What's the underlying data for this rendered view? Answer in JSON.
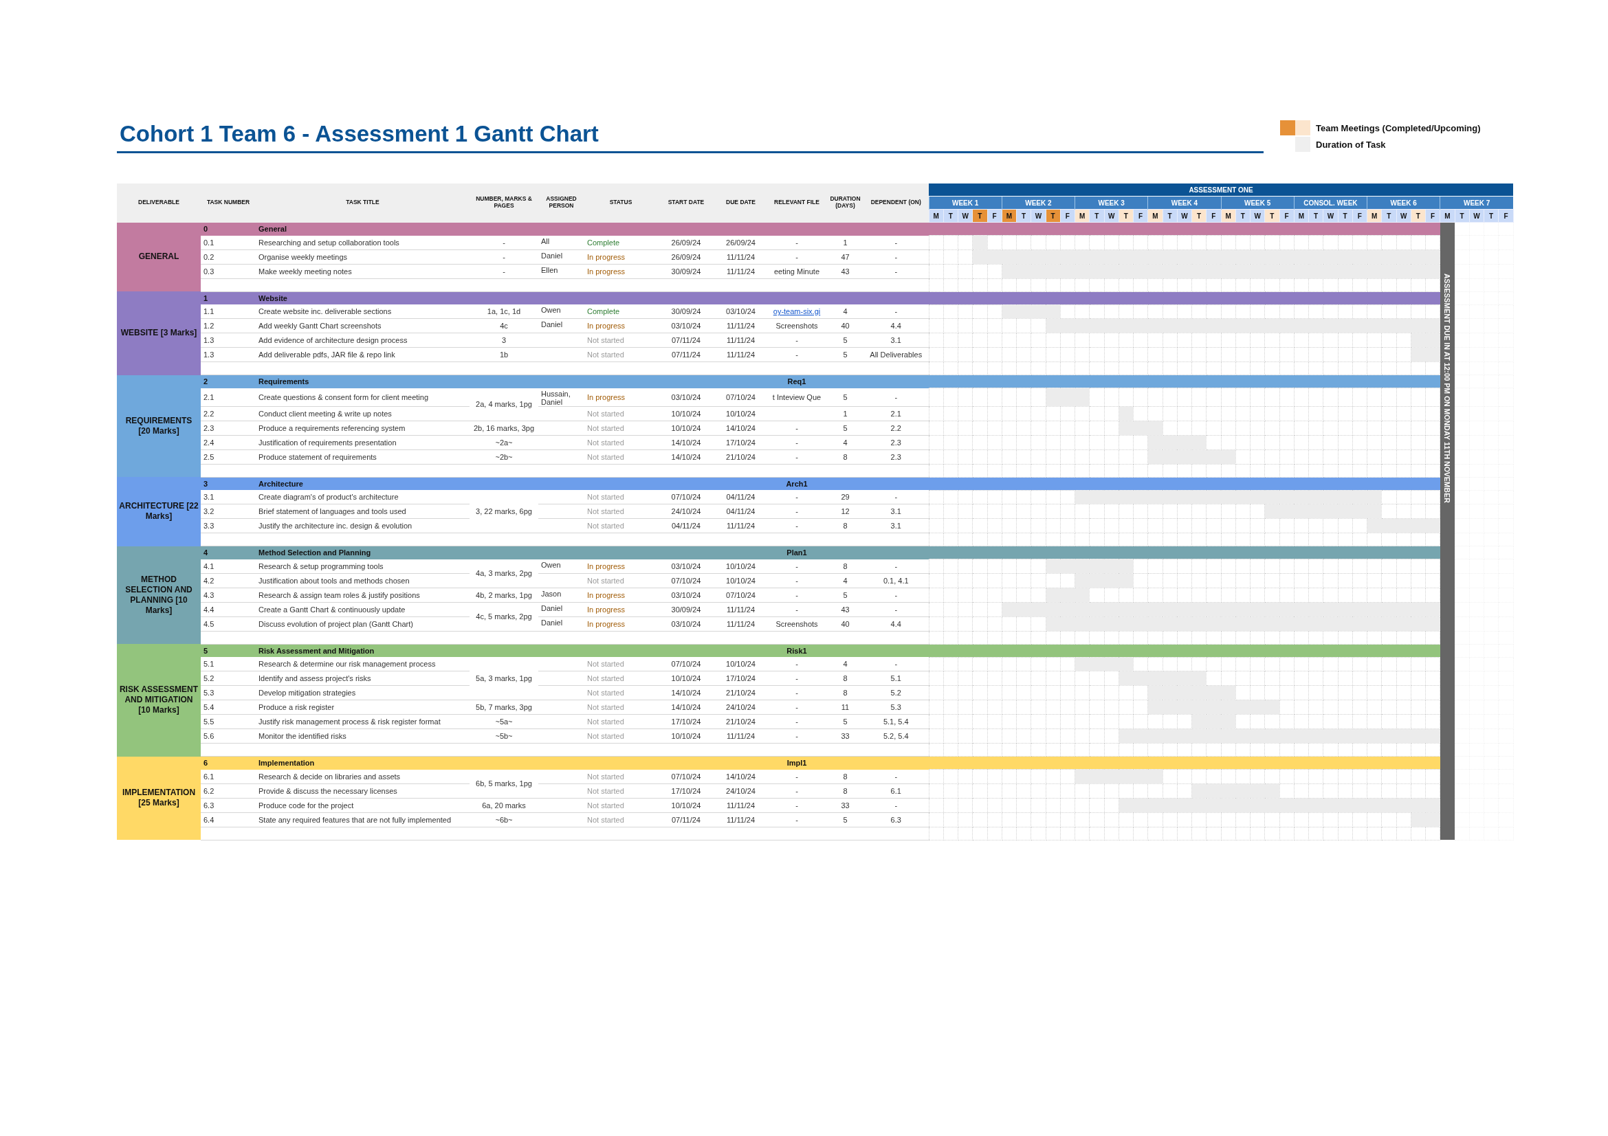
{
  "title": "Cohort 1 Team 6 - Assessment 1 Gantt Chart",
  "legend": [
    {
      "label": "Team Meetings (Completed/Upcoming)",
      "kind": "meetings"
    },
    {
      "label": "Duration of Task",
      "kind": "duration"
    }
  ],
  "columns": [
    "DELIVERABLE",
    "TASK NUMBER",
    "TASK TITLE",
    "NUMBER, MARKS & PAGES",
    "ASSIGNED PERSON",
    "STATUS",
    "START DATE",
    "DUE DATE",
    "RELEVANT FILE",
    "DURATION (DAYS)",
    "DEPENDENT (ON)"
  ],
  "gantt": {
    "title": "ASSESSMENT ONE",
    "deadline": "ASSESSMENT DUE IN AT 12:00 PM ON MONDAY 11TH NOVEMBER",
    "weeks": [
      {
        "label": "WEEK 1",
        "days": [
          {
            "label": "M",
            "completed_meeting": false,
            "upcoming_meeting": false
          },
          {
            "label": "T",
            "completed_meeting": false,
            "upcoming_meeting": false
          },
          {
            "label": "W",
            "completed_meeting": false,
            "upcoming_meeting": false
          },
          {
            "label": "T",
            "completed_meeting": true,
            "upcoming_meeting": false
          },
          {
            "label": "F",
            "completed_meeting": false,
            "upcoming_meeting": false
          }
        ]
      },
      {
        "label": "WEEK 2",
        "days": [
          {
            "label": "M",
            "completed_meeting": true,
            "upcoming_meeting": false
          },
          {
            "label": "T",
            "completed_meeting": false,
            "upcoming_meeting": false
          },
          {
            "label": "W",
            "completed_meeting": false,
            "upcoming_meeting": false
          },
          {
            "label": "T",
            "completed_meeting": true,
            "upcoming_meeting": false
          },
          {
            "label": "F",
            "completed_meeting": false,
            "upcoming_meeting": false
          }
        ]
      },
      {
        "label": "WEEK 3",
        "days": [
          {
            "label": "M",
            "completed_meeting": false,
            "upcoming_meeting": true
          },
          {
            "label": "T",
            "completed_meeting": false,
            "upcoming_meeting": false
          },
          {
            "label": "W",
            "completed_meeting": false,
            "upcoming_meeting": false
          },
          {
            "label": "T",
            "completed_meeting": false,
            "upcoming_meeting": true
          },
          {
            "label": "F",
            "completed_meeting": false,
            "upcoming_meeting": false
          }
        ]
      },
      {
        "label": "WEEK 4",
        "days": [
          {
            "label": "M",
            "completed_meeting": false,
            "upcoming_meeting": true
          },
          {
            "label": "T",
            "completed_meeting": false,
            "upcoming_meeting": false
          },
          {
            "label": "W",
            "completed_meeting": false,
            "upcoming_meeting": false
          },
          {
            "label": "T",
            "completed_meeting": false,
            "upcoming_meeting": true
          },
          {
            "label": "F",
            "completed_meeting": false,
            "upcoming_meeting": false
          }
        ]
      },
      {
        "label": "WEEK 5",
        "days": [
          {
            "label": "M",
            "completed_meeting": false,
            "upcoming_meeting": true
          },
          {
            "label": "T",
            "completed_meeting": false,
            "upcoming_meeting": false
          },
          {
            "label": "W",
            "completed_meeting": false,
            "upcoming_meeting": false
          },
          {
            "label": "T",
            "completed_meeting": false,
            "upcoming_meeting": true
          },
          {
            "label": "F",
            "completed_meeting": false,
            "upcoming_meeting": false
          }
        ]
      },
      {
        "label": "CONSOL. WEEK",
        "days": [
          {
            "label": "M",
            "completed_meeting": false,
            "upcoming_meeting": false
          },
          {
            "label": "T",
            "completed_meeting": false,
            "upcoming_meeting": false
          },
          {
            "label": "W",
            "completed_meeting": false,
            "upcoming_meeting": false
          },
          {
            "label": "T",
            "completed_meeting": false,
            "upcoming_meeting": false
          },
          {
            "label": "F",
            "completed_meeting": false,
            "upcoming_meeting": false
          }
        ]
      },
      {
        "label": "WEEK 6",
        "days": [
          {
            "label": "M",
            "completed_meeting": false,
            "upcoming_meeting": true
          },
          {
            "label": "T",
            "completed_meeting": false,
            "upcoming_meeting": false
          },
          {
            "label": "W",
            "completed_meeting": false,
            "upcoming_meeting": false
          },
          {
            "label": "T",
            "completed_meeting": false,
            "upcoming_meeting": true
          },
          {
            "label": "F",
            "completed_meeting": false,
            "upcoming_meeting": false
          }
        ]
      },
      {
        "label": "WEEK 7",
        "days": [
          {
            "label": "M",
            "completed_meeting": false,
            "upcoming_meeting": false
          },
          {
            "label": "T",
            "completed_meeting": false,
            "upcoming_meeting": false
          },
          {
            "label": "W",
            "completed_meeting": false,
            "upcoming_meeting": false
          },
          {
            "label": "T",
            "completed_meeting": false,
            "upcoming_meeting": false
          },
          {
            "label": "F",
            "completed_meeting": false,
            "upcoming_meeting": false
          }
        ]
      }
    ]
  },
  "groups": [
    {
      "deliverable": "GENERAL",
      "color": "#c27ba0",
      "number": "0",
      "title": "General",
      "blocks": [
        {
          "marks": "-",
          "tasks": [
            {
              "number": "0.1",
              "title": "Researching and setup collaboration tools",
              "assigned": "All",
              "status": "Complete",
              "kind": "complete",
              "start": "26/09/24",
              "due": "26/09/24",
              "file": "-",
              "file_is_link": false,
              "duration": "1",
              "dependent": "-"
            }
          ]
        },
        {
          "marks": "-",
          "tasks": [
            {
              "number": "0.2",
              "title": "Organise weekly meetings",
              "assigned": "Daniel",
              "status": "In progress",
              "kind": "in_progress",
              "start": "26/09/24",
              "due": "11/11/24",
              "file": "-",
              "file_is_link": false,
              "duration": "47",
              "dependent": "-"
            }
          ]
        },
        {
          "marks": "-",
          "tasks": [
            {
              "number": "0.3",
              "title": "Make weekly meeting notes",
              "assigned": "Ellen",
              "status": "In progress",
              "kind": "in_progress",
              "start": "30/09/24",
              "due": "11/11/24",
              "file": "eeting Minute",
              "file_is_link": false,
              "duration": "43",
              "dependent": "-"
            }
          ]
        }
      ]
    },
    {
      "deliverable": "WEBSITE [3 Marks]",
      "color": "#8e7cc3",
      "number": "1",
      "title": "Website",
      "blocks": [
        {
          "marks": "1a, 1c, 1d",
          "tasks": [
            {
              "number": "1.1",
              "title": "Create website inc. deliverable sections",
              "assigned": "Owen",
              "status": "Complete",
              "kind": "complete",
              "start": "30/09/24",
              "due": "03/10/24",
              "file": "oy-team-six.gi",
              "file_is_link": true,
              "duration": "4",
              "dependent": "-"
            }
          ]
        },
        {
          "marks": "4c",
          "tasks": [
            {
              "number": "1.2",
              "title": "Add weekly Gantt Chart screenshots",
              "assigned": "Daniel",
              "status": "In progress",
              "kind": "in_progress",
              "start": "03/10/24",
              "due": "11/11/24",
              "file": "Screenshots",
              "file_is_link": false,
              "duration": "40",
              "dependent": "4.4"
            }
          ]
        },
        {
          "marks": "3",
          "tasks": [
            {
              "number": "1.3",
              "title": "Add evidence of architecture design process",
              "status": "Not started",
              "kind": "not_started",
              "start": "07/11/24",
              "due": "11/11/24",
              "file": "-",
              "file_is_link": false,
              "duration": "5",
              "dependent": "3.1"
            }
          ]
        },
        {
          "marks": "1b",
          "tasks": [
            {
              "number": "1.3",
              "title": "Add deliverable pdfs, JAR file & repo link",
              "status": "Not started",
              "kind": "not_started",
              "start": "07/11/24",
              "due": "11/11/24",
              "file": "-",
              "file_is_link": false,
              "duration": "5",
              "dependent": "All Deliverables"
            }
          ]
        }
      ]
    },
    {
      "deliverable": "REQUIREMENTS [20 Marks]",
      "color": "#6fa8dc",
      "number": "2",
      "title": "Requirements",
      "code": "Req1",
      "blocks": [
        {
          "marks": "2a, 4 marks, 1pg",
          "tasks": [
            {
              "number": "2.1",
              "title": "Create questions & consent form for client meeting",
              "assigned": "Hussain, Daniel",
              "status": "In progress",
              "kind": "in_progress",
              "start": "03/10/24",
              "due": "07/10/24",
              "file": "t Inteview Que",
              "file_is_link": false,
              "duration": "5",
              "dependent": "-"
            },
            {
              "number": "2.2",
              "title": "Conduct client meeting & write up notes",
              "status": "Not started",
              "kind": "not_started",
              "start": "10/10/24",
              "due": "10/10/24",
              "duration": "1",
              "dependent": "2.1"
            }
          ]
        },
        {
          "marks": "2b, 16 marks, 3pg",
          "tasks": [
            {
              "number": "2.3",
              "title": "Produce a requirements referencing system",
              "status": "Not started",
              "kind": "not_started",
              "start": "10/10/24",
              "due": "14/10/24",
              "file": "-",
              "file_is_link": false,
              "duration": "5",
              "dependent": "2.2"
            }
          ]
        },
        {
          "marks": "~2a~",
          "tasks": [
            {
              "number": "2.4",
              "title": "Justification of requirements presentation",
              "status": "Not started",
              "kind": "not_started",
              "start": "14/10/24",
              "due": "17/10/24",
              "file": "-",
              "file_is_link": false,
              "duration": "4",
              "dependent": "2.3"
            }
          ]
        },
        {
          "marks": "~2b~",
          "tasks": [
            {
              "number": "2.5",
              "title": "Produce statement of requirements",
              "status": "Not started",
              "kind": "not_started",
              "start": "14/10/24",
              "due": "21/10/24",
              "file": "-",
              "file_is_link": false,
              "duration": "8",
              "dependent": "2.3"
            }
          ]
        }
      ]
    },
    {
      "deliverable": "ARCHITECTURE [22 Marks]",
      "color": "#6d9eeb",
      "number": "3",
      "title": "Architecture",
      "code": "Arch1",
      "blocks": [
        {
          "marks": "3, 22 marks, 6pg",
          "tasks": [
            {
              "number": "3.1",
              "title": "Create diagram's of product's architecture",
              "status": "Not started",
              "kind": "not_started",
              "start": "07/10/24",
              "due": "04/11/24",
              "file": "-",
              "file_is_link": false,
              "duration": "29",
              "dependent": "-"
            },
            {
              "number": "3.2",
              "title": "Brief statement of languages and tools used",
              "status": "Not started",
              "kind": "not_started",
              "start": "24/10/24",
              "due": "04/11/24",
              "file": "-",
              "file_is_link": false,
              "duration": "12",
              "dependent": "3.1"
            },
            {
              "number": "3.3",
              "title": "Justify the architecture inc. design & evolution",
              "status": "Not started",
              "kind": "not_started",
              "start": "04/11/24",
              "due": "11/11/24",
              "file": "-",
              "file_is_link": false,
              "duration": "8",
              "dependent": "3.1"
            }
          ]
        }
      ]
    },
    {
      "deliverable": "METHOD SELECTION AND PLANNING [10 Marks]",
      "color": "#76a5af",
      "number": "4",
      "title": "Method Selection and Planning",
      "code": "Plan1",
      "blocks": [
        {
          "marks": "4a, 3 marks, 2pg",
          "tasks": [
            {
              "number": "4.1",
              "title": "Research & setup programming tools",
              "assigned": "Owen",
              "status": "In progress",
              "kind": "in_progress",
              "start": "03/10/24",
              "due": "10/10/24",
              "file": "-",
              "file_is_link": false,
              "duration": "8",
              "dependent": "-"
            },
            {
              "number": "4.2",
              "title": "Justification about tools and methods chosen",
              "status": "Not started",
              "kind": "not_started",
              "start": "07/10/24",
              "due": "10/10/24",
              "file": "-",
              "file_is_link": false,
              "duration": "4",
              "dependent": "0.1, 4.1"
            }
          ]
        },
        {
          "marks": "4b, 2 marks, 1pg",
          "tasks": [
            {
              "number": "4.3",
              "title": "Research & assign team roles & justify positions",
              "assigned": "Jason",
              "status": "In progress",
              "kind": "in_progress",
              "start": "03/10/24",
              "due": "07/10/24",
              "file": "-",
              "file_is_link": false,
              "duration": "5",
              "dependent": "-"
            }
          ]
        },
        {
          "marks": "4c, 5 marks, 2pg",
          "tasks": [
            {
              "number": "4.4",
              "title": "Create a Gantt Chart & continuously update",
              "assigned": "Daniel",
              "status": "In progress",
              "kind": "in_progress",
              "start": "30/09/24",
              "due": "11/11/24",
              "file": "-",
              "file_is_link": false,
              "duration": "43",
              "dependent": "-"
            },
            {
              "number": "4.5",
              "title": "Discuss evolution of project plan (Gantt Chart)",
              "assigned": "Daniel",
              "status": "In progress",
              "kind": "in_progress",
              "start": "03/10/24",
              "due": "11/11/24",
              "file": "Screenshots",
              "file_is_link": false,
              "duration": "40",
              "dependent": "4.4"
            }
          ]
        }
      ]
    },
    {
      "deliverable": "RISK ASSESSMENT AND MITIGATION [10 Marks]",
      "color": "#93c47d",
      "number": "5",
      "title": "Risk Assessment and Mitigation",
      "code": "Risk1",
      "blocks": [
        {
          "marks": "5a, 3 marks, 1pg",
          "tasks": [
            {
              "number": "5.1",
              "title": "Research & determine our risk management process",
              "status": "Not started",
              "kind": "not_started",
              "start": "07/10/24",
              "due": "10/10/24",
              "file": "-",
              "file_is_link": false,
              "duration": "4",
              "dependent": "-"
            },
            {
              "number": "5.2",
              "title": "Identify and assess project's risks",
              "status": "Not started",
              "kind": "not_started",
              "start": "10/10/24",
              "due": "17/10/24",
              "file": "-",
              "file_is_link": false,
              "duration": "8",
              "dependent": "5.1"
            },
            {
              "number": "5.3",
              "title": "Develop mitigation strategies",
              "status": "Not started",
              "kind": "not_started",
              "start": "14/10/24",
              "due": "21/10/24",
              "file": "-",
              "file_is_link": false,
              "duration": "8",
              "dependent": "5.2"
            }
          ]
        },
        {
          "marks": "5b, 7 marks, 3pg",
          "tasks": [
            {
              "number": "5.4",
              "title": "Produce a risk register",
              "status": "Not started",
              "kind": "not_started",
              "start": "14/10/24",
              "due": "24/10/24",
              "file": "-",
              "file_is_link": false,
              "duration": "11",
              "dependent": "5.3"
            }
          ]
        },
        {
          "marks": "~5a~",
          "tasks": [
            {
              "number": "5.5",
              "title": "Justify risk management process & risk register format",
              "status": "Not started",
              "kind": "not_started",
              "start": "17/10/24",
              "due": "21/10/24",
              "file": "-",
              "file_is_link": false,
              "duration": "5",
              "dependent": "5.1, 5.4"
            }
          ]
        },
        {
          "marks": "~5b~",
          "tasks": [
            {
              "number": "5.6",
              "title": "Monitor the identified risks",
              "status": "Not started",
              "kind": "not_started",
              "start": "10/10/24",
              "due": "11/11/24",
              "file": "-",
              "file_is_link": false,
              "duration": "33",
              "dependent": "5.2, 5.4"
            }
          ]
        }
      ]
    },
    {
      "deliverable": "IMPLEMENTATION [25 Marks]",
      "color": "#ffd966",
      "number": "6",
      "title": "Implementation",
      "code": "Impl1",
      "blocks": [
        {
          "marks": "6b, 5 marks, 1pg",
          "tasks": [
            {
              "number": "6.1",
              "title": "Research & decide on libraries and assets",
              "status": "Not started",
              "kind": "not_started",
              "start": "07/10/24",
              "due": "14/10/24",
              "file": "-",
              "file_is_link": false,
              "duration": "8",
              "dependent": "-"
            },
            {
              "number": "6.2",
              "title": "Provide & discuss the necessary licenses",
              "status": "Not started",
              "kind": "not_started",
              "start": "17/10/24",
              "due": "24/10/24",
              "file": "-",
              "file_is_link": false,
              "duration": "8",
              "dependent": "6.1"
            }
          ]
        },
        {
          "marks": "6a, 20 marks",
          "tasks": [
            {
              "number": "6.3",
              "title": "Produce code for the project",
              "status": "Not started",
              "kind": "not_started",
              "start": "10/10/24",
              "due": "11/11/24",
              "file": "-",
              "file_is_link": false,
              "duration": "33",
              "dependent": "-"
            }
          ]
        },
        {
          "marks": "~6b~",
          "tasks": [
            {
              "number": "6.4",
              "title": "State any required features that are not fully implemented",
              "status": "Not started",
              "kind": "not_started",
              "start": "07/11/24",
              "due": "11/11/24",
              "file": "-",
              "file_is_link": false,
              "duration": "5",
              "dependent": "6.3"
            }
          ]
        }
      ]
    }
  ]
}
